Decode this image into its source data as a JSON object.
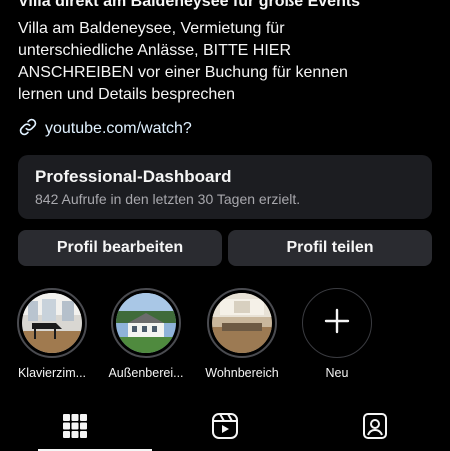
{
  "profile": {
    "title": "Villa direkt am Baldeneysee für große Events",
    "bio_lines": [
      "Villa am Baldeneysee, Vermietung für",
      "unterschiedliche Anlässe, BITTE HIER",
      "ANSCHREIBEN vor einer Buchung für kennen",
      "lernen und Details besprechen"
    ],
    "link": "youtube.com/watch?",
    "link_icon": "link-icon"
  },
  "dashboard": {
    "title": "Professional-Dashboard",
    "subtitle": "842 Aufrufe in den letzten 30 Tagen erzielt."
  },
  "buttons": {
    "edit": "Profil bearbeiten",
    "share": "Profil teilen"
  },
  "highlights": [
    {
      "label": "Klavierzim..."
    },
    {
      "label": "Außenberei..."
    },
    {
      "label": "Wohnbereich"
    },
    {
      "label": "Neu"
    }
  ],
  "tabs": [
    {
      "icon": "grid-icon",
      "active": true
    },
    {
      "icon": "reels-icon",
      "active": false
    },
    {
      "icon": "tagged-icon",
      "active": false
    }
  ],
  "colors": {
    "background": "#000000",
    "card": "#1c1d21",
    "button": "#2a2b30",
    "text": "#f5f5f5",
    "muted": "#a8a8ad"
  }
}
